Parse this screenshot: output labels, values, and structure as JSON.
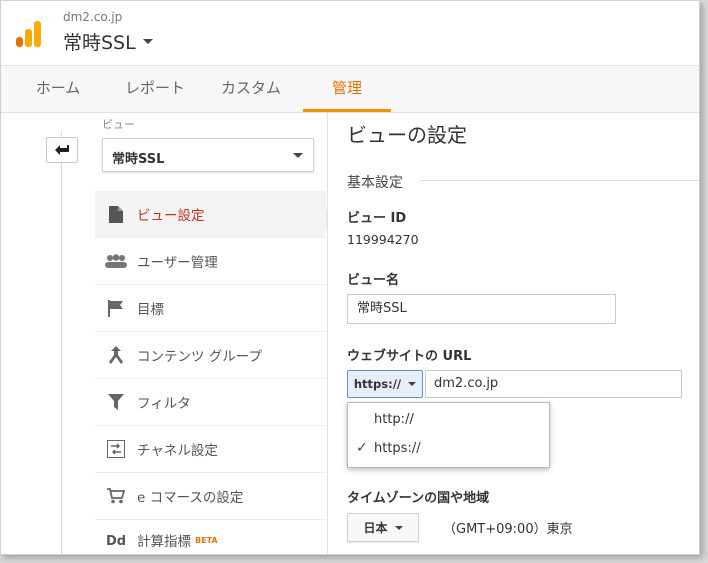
{
  "header": {
    "account_domain": "dm2.co.jp",
    "property_name": "常時SSL",
    "colors": {
      "logo_dark": "#e37400",
      "logo_light": "#f9ab00"
    }
  },
  "nav": {
    "tabs": [
      {
        "label": "ホーム"
      },
      {
        "label": "レポート"
      },
      {
        "label": "カスタム"
      },
      {
        "label": "管理"
      }
    ],
    "active_tab": "管理",
    "active_color": "#f09300"
  },
  "sidebar": {
    "view_caption": "ビュー",
    "view_selected": "常時SSL",
    "items": [
      {
        "label": "ビュー設定",
        "icon": "document-icon"
      },
      {
        "label": "ユーザー管理",
        "icon": "people-icon"
      },
      {
        "label": "目標",
        "icon": "flag-icon"
      },
      {
        "label": "コンテンツ グループ",
        "icon": "content-group-icon"
      },
      {
        "label": "フィルタ",
        "icon": "filter-icon"
      },
      {
        "label": "チャネル設定",
        "icon": "channel-settings-icon"
      },
      {
        "label": "e コマースの設定",
        "icon": "cart-icon"
      },
      {
        "label": "計算指標",
        "icon": "dd-icon",
        "badge": "BETA"
      }
    ],
    "selected_item": "ビュー設定"
  },
  "main": {
    "title": "ビューの設定",
    "section": "基本設定",
    "view_id_label": "ビュー ID",
    "view_id": "119994270",
    "view_name_label": "ビュー名",
    "view_name_value": "常時SSL",
    "url_label": "ウェブサイトの URL",
    "protocol_selected": "https://",
    "url_value": "dm2.co.jp",
    "protocol_options": [
      {
        "label": "http://",
        "checked": false
      },
      {
        "label": "https://",
        "checked": true
      }
    ],
    "timezone_label": "タイムゾーンの国や地域",
    "country_selected": "日本",
    "timezone_value": "（GMT+09:00）東京"
  }
}
